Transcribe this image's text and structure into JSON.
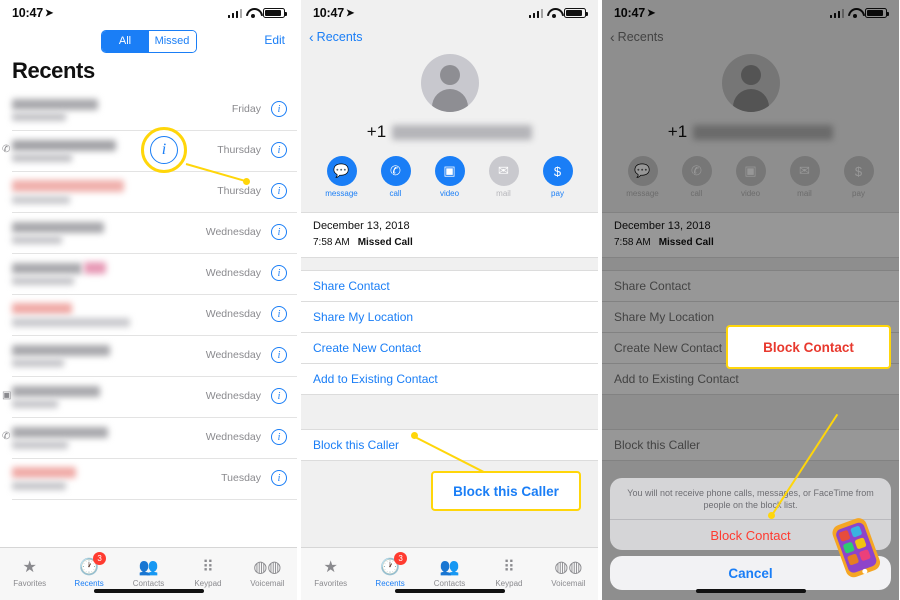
{
  "status_bar": {
    "time": "10:47",
    "location_icon": "location-arrow-icon",
    "signal": "signal-bars-icon",
    "wifi": "wifi-icon",
    "battery": "battery-icon"
  },
  "panel1": {
    "segmented": {
      "options": [
        "All",
        "Missed"
      ],
      "selected": "All"
    },
    "edit_label": "Edit",
    "title": "Recents",
    "rows": [
      {
        "day": "Friday",
        "info": "i",
        "redacted": true,
        "missed": false,
        "left_icon": ""
      },
      {
        "day": "Thursday",
        "info": "i",
        "redacted": true,
        "missed": false,
        "left_icon": "phone-icon"
      },
      {
        "day": "Thursday",
        "info": "i",
        "redacted": true,
        "missed": true,
        "left_icon": ""
      },
      {
        "day": "Wednesday",
        "info": "i",
        "redacted": true,
        "missed": false,
        "left_icon": ""
      },
      {
        "day": "Wednesday",
        "info": "i",
        "redacted": true,
        "missed": false,
        "left_icon": ""
      },
      {
        "day": "Wednesday",
        "info": "i",
        "redacted": true,
        "missed": true,
        "left_icon": ""
      },
      {
        "day": "Wednesday",
        "info": "i",
        "redacted": true,
        "missed": false,
        "left_icon": ""
      },
      {
        "day": "Wednesday",
        "info": "i",
        "redacted": true,
        "missed": false,
        "left_icon": "video-icon"
      },
      {
        "day": "Wednesday",
        "info": "i",
        "redacted": true,
        "missed": false,
        "left_icon": "phone-icon"
      },
      {
        "day": "Tuesday",
        "info": "i",
        "redacted": true,
        "missed": true,
        "left_icon": ""
      }
    ],
    "callout_info_icon": "i"
  },
  "tabbar": {
    "items": [
      {
        "label": "Favorites",
        "icon": "star-icon",
        "active": false,
        "badge": ""
      },
      {
        "label": "Recents",
        "icon": "clock-icon",
        "active": true,
        "badge": "3"
      },
      {
        "label": "Contacts",
        "icon": "contacts-icon",
        "active": false,
        "badge": ""
      },
      {
        "label": "Keypad",
        "icon": "keypad-icon",
        "active": false,
        "badge": ""
      },
      {
        "label": "Voicemail",
        "icon": "voicemail-icon",
        "active": false,
        "badge": ""
      }
    ]
  },
  "panel2": {
    "back_label": "Recents",
    "avatar": "person-avatar",
    "number_prefix": "+1",
    "number_redacted": true,
    "actions": [
      {
        "label": "message",
        "icon": "message-icon",
        "enabled": true
      },
      {
        "label": "call",
        "icon": "phone-icon",
        "enabled": true
      },
      {
        "label": "video",
        "icon": "video-icon",
        "enabled": true
      },
      {
        "label": "mail",
        "icon": "mail-icon",
        "enabled": false
      },
      {
        "label": "pay",
        "icon": "pay-icon",
        "enabled": true
      }
    ],
    "call_date": "December 13, 2018",
    "call_time": "7:58 AM",
    "call_type": "Missed Call",
    "links": [
      "Share Contact",
      "Share My Location",
      "Create New Contact",
      "Add to Existing Contact"
    ],
    "block_label": "Block this Caller",
    "callout": "Block this Caller"
  },
  "panel3": {
    "back_label": "Recents",
    "number_prefix": "+1",
    "actions": [
      {
        "label": "message",
        "icon": "message-icon"
      },
      {
        "label": "call",
        "icon": "phone-icon"
      },
      {
        "label": "video",
        "icon": "video-icon"
      },
      {
        "label": "mail",
        "icon": "mail-icon"
      },
      {
        "label": "pay",
        "icon": "pay-icon"
      }
    ],
    "call_date": "December 13, 2018",
    "call_time": "7:58 AM",
    "call_type": "Missed Call",
    "links": [
      "Share Contact",
      "Share My Location",
      "Create New Contact",
      "Add to Existing Contact"
    ],
    "block_label": "Block this Caller",
    "sheet": {
      "message": "You will not receive phone calls, messages, or FaceTime from people on the block list.",
      "confirm": "Block Contact",
      "cancel": "Cancel"
    },
    "callout": "Block Contact"
  },
  "colors": {
    "accent": "#1a7ef6",
    "highlight": "#ffd60a",
    "destructive": "#ff3b30",
    "callout_red": "#e8392e",
    "badge": "#ff3b30"
  }
}
